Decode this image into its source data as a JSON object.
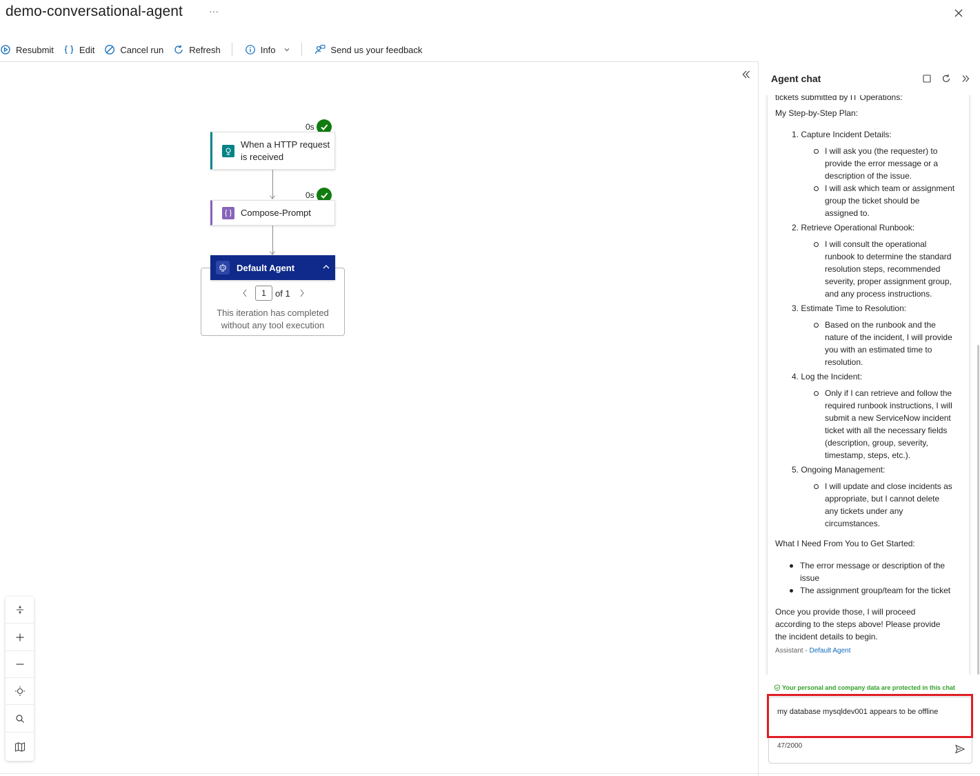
{
  "window": {
    "title": "demo-conversational-agent",
    "more_label": "···"
  },
  "toolbar": {
    "resubmit": "Resubmit",
    "edit": "Edit",
    "cancel_run": "Cancel run",
    "refresh": "Refresh",
    "info": "Info",
    "feedback": "Send us your feedback"
  },
  "canvas": {
    "nodes": {
      "http": {
        "label_line1": "When a HTTP request",
        "label_line2": "is received",
        "duration": "0s",
        "status": "succeeded"
      },
      "compose": {
        "label": "Compose-Prompt",
        "duration": "0s",
        "status": "succeeded"
      },
      "agent": {
        "label": "Default Agent",
        "iteration_current": "1",
        "iteration_of": "of 1",
        "message_line1": "This iteration has completed",
        "message_line2": "without any tool execution"
      }
    },
    "colors": {
      "http_accent": "#038387",
      "compose_accent": "#8764b8",
      "agent_header": "#0f2a8a",
      "success": "#107c10"
    }
  },
  "zoom_controls": [
    "fit-to-width-icon",
    "zoom-in-icon",
    "zoom-out-icon",
    "center-icon",
    "search-icon",
    "minimap-icon"
  ],
  "agent_chat": {
    "title": "Agent chat",
    "message": {
      "intro_tail": "tickets submitted by IT Operations:",
      "plan_heading": "My Step-by-Step Plan:",
      "steps": [
        {
          "title": "1. Capture Incident Details:",
          "bullets": [
            [
              "I will ask you (the requester) to",
              "provide the error message or a",
              "description of the issue."
            ],
            [
              "I will ask which team or assignment",
              "group the ticket should be",
              "assigned to."
            ]
          ]
        },
        {
          "title": "2. Retrieve Operational Runbook:",
          "bullets": [
            [
              "I will consult the operational",
              "runbook to determine the standard",
              "resolution steps, recommended",
              "severity, proper assignment group,",
              "and any process instructions."
            ]
          ]
        },
        {
          "title": "3. Estimate Time to Resolution:",
          "bullets": [
            [
              "Based on the runbook and the",
              "nature of the incident, I will provide",
              "you with an estimated time to",
              "resolution."
            ]
          ]
        },
        {
          "title": "4. Log the Incident:",
          "bullets": [
            [
              "Only if I can retrieve and follow the",
              "required runbook instructions, I will",
              "submit a new ServiceNow incident",
              "ticket with all the necessary fields",
              "(description, group, severity,",
              "timestamp, steps, etc.)."
            ]
          ]
        },
        {
          "title": "5. Ongoing Management:",
          "bullets": [
            [
              "I will update and close incidents as",
              "appropriate, but I cannot delete",
              "any tickets under any",
              "circumstances."
            ]
          ]
        }
      ],
      "need_heading": "What I Need From You to Get Started:",
      "needs": [
        [
          "The error message or description of the",
          "issue"
        ],
        [
          "The assignment group/team for the ticket"
        ]
      ],
      "closing": [
        "Once you provide those, I will proceed",
        "according to the steps above! Please provide",
        "the incident details to begin."
      ],
      "author_prefix": "Assistant - ",
      "author_name": "Default Agent"
    },
    "protection_notice": "Your personal and company data are protected in this chat",
    "input_value": "my database mysqldev001 appears to be offline",
    "char_count": "47/2000",
    "highlight_color": "#e11d24"
  }
}
